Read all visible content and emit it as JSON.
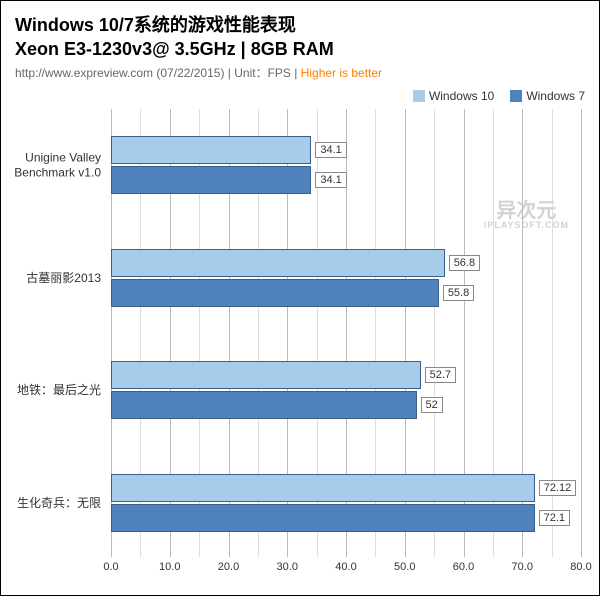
{
  "title_line1": "Windows 10/7系统的游戏性能表现",
  "title_line2": "Xeon E3-1230v3@ 3.5GHz | 8GB RAM",
  "subtitle_prefix": "http://www.expreview.com (07/22/2015) | Unit：FPS | ",
  "subtitle_highlight": "Higher is better",
  "legend": {
    "w10": "Windows 10",
    "w7": "Windows 7"
  },
  "watermark": {
    "main": "异次元",
    "sub": "IPLAYSOFT.COM"
  },
  "chart_data": {
    "type": "bar",
    "orientation": "horizontal",
    "xlabel": "",
    "ylabel": "",
    "xlim": [
      0,
      80
    ],
    "xticks": [
      0.0,
      10.0,
      20.0,
      30.0,
      40.0,
      50.0,
      60.0,
      70.0,
      80.0
    ],
    "xtick_labels": [
      "0.0",
      "10.0",
      "20.0",
      "30.0",
      "40.0",
      "50.0",
      "60.0",
      "70.0",
      "80.0"
    ],
    "categories": [
      "Unigine Valley Benchmark v1.0",
      "古墓丽影2013",
      "地铁：最后之光",
      "生化奇兵：无限"
    ],
    "category_labels": [
      "Unigine Valley\nBenchmark v1.0",
      "古墓丽影2013",
      "地铁：最后之光",
      "生化奇兵：无限"
    ],
    "series": [
      {
        "name": "Windows 10",
        "values": [
          34.1,
          56.8,
          52.7,
          72.12
        ],
        "labels": [
          "34.1",
          "56.8",
          "52.7",
          "72.12"
        ]
      },
      {
        "name": "Windows 7",
        "values": [
          34.1,
          55.8,
          52.0,
          72.1
        ],
        "labels": [
          "34.1",
          "55.8",
          "52",
          "72.1"
        ]
      }
    ],
    "legend_position": "top-right",
    "grid": true
  }
}
